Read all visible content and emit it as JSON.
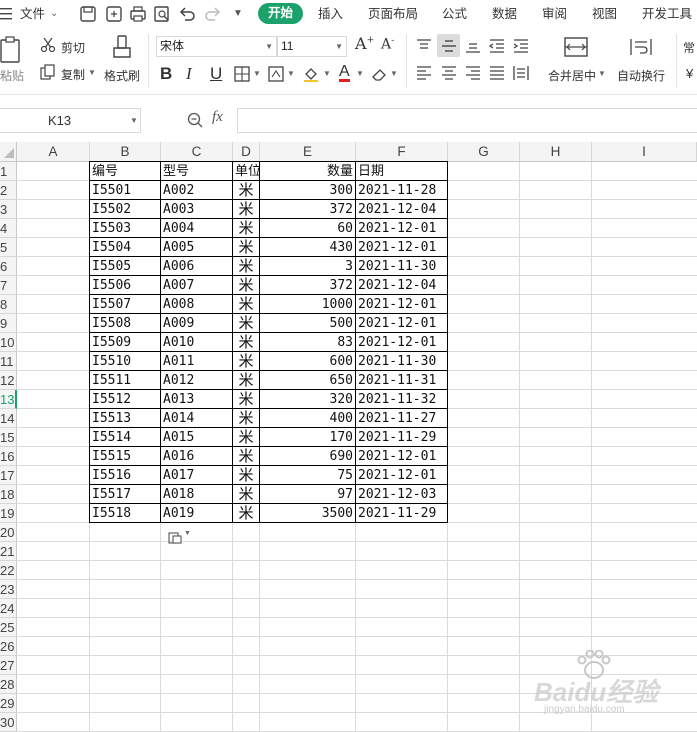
{
  "menubar": {
    "file_menu": "文件",
    "tabs": [
      "开始",
      "插入",
      "页面布局",
      "公式",
      "数据",
      "审阅",
      "视图",
      "开发工具"
    ],
    "icons": [
      "hamburger-icon",
      "save-icon",
      "export-icon",
      "print-icon",
      "print-preview-icon",
      "undo-icon",
      "redo-icon",
      "more-icon"
    ]
  },
  "ribbon": {
    "paste_label": "粘贴",
    "cut_label": "剪切",
    "copy_label": "复制",
    "format_painter_label": "格式刷",
    "font_name": "宋体",
    "font_size": "11",
    "bold": "B",
    "italic": "I",
    "underline": "U",
    "font_color_letter": "A",
    "merge_center_label": "合并居中",
    "wrap_text_label": "自动换行",
    "number_format_label": "常"
  },
  "formula_bar": {
    "name_box": "K13",
    "fx_label": "fx",
    "formula": ""
  },
  "grid": {
    "columns": [
      "A",
      "B",
      "C",
      "D",
      "E",
      "F",
      "G",
      "H",
      "I"
    ],
    "row_numbers": [
      "1",
      "2",
      "3",
      "4",
      "5",
      "6",
      "7",
      "8",
      "9",
      "10",
      "11",
      "12",
      "13",
      "14",
      "15",
      "16",
      "17",
      "18",
      "19",
      "20",
      "21",
      "22",
      "23",
      "24",
      "25",
      "26",
      "27",
      "28",
      "29",
      "30"
    ],
    "selected_row": "13",
    "headers": [
      "编号",
      "型号",
      "单位",
      "数量",
      "日期"
    ],
    "rows": [
      [
        "I5501",
        "A002",
        "米",
        "300",
        "2021-11-28"
      ],
      [
        "I5502",
        "A003",
        "米",
        "372",
        "2021-12-04"
      ],
      [
        "I5503",
        "A004",
        "米",
        "60",
        "2021-12-01"
      ],
      [
        "I5504",
        "A005",
        "米",
        "430",
        "2021-12-01"
      ],
      [
        "I5505",
        "A006",
        "米",
        "3",
        "2021-11-30"
      ],
      [
        "I5506",
        "A007",
        "米",
        "372",
        "2021-12-04"
      ],
      [
        "I5507",
        "A008",
        "米",
        "1000",
        "2021-12-01"
      ],
      [
        "I5508",
        "A009",
        "米",
        "500",
        "2021-12-01"
      ],
      [
        "I5509",
        "A010",
        "米",
        "83",
        "2021-12-01"
      ],
      [
        "I5510",
        "A011",
        "米",
        "600",
        "2021-11-30"
      ],
      [
        "I5511",
        "A012",
        "米",
        "650",
        "2021-11-31"
      ],
      [
        "I5512",
        "A013",
        "米",
        "320",
        "2021-11-32"
      ],
      [
        "I5513",
        "A014",
        "米",
        "400",
        "2021-11-27"
      ],
      [
        "I5514",
        "A015",
        "米",
        "170",
        "2021-11-29"
      ],
      [
        "I5515",
        "A016",
        "米",
        "690",
        "2021-12-01"
      ],
      [
        "I5516",
        "A017",
        "米",
        "75",
        "2021-12-01"
      ],
      [
        "I5517",
        "A018",
        "米",
        "97",
        "2021-12-03"
      ],
      [
        "I5518",
        "A019",
        "米",
        "3500",
        "2021-11-29"
      ]
    ]
  },
  "watermark": {
    "brand": "Baidu经验",
    "url": "jingyan.baidu.com"
  },
  "colors": {
    "accent": "#1aa26a",
    "gridline": "#dadada",
    "header_bg": "#f4f4f4"
  }
}
